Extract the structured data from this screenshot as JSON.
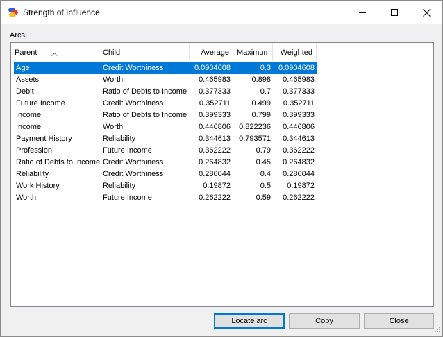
{
  "window": {
    "title": "Strength of Influence",
    "app_icon": "network-icon",
    "controls": [
      "minimize-icon",
      "maximize-icon",
      "close-icon"
    ]
  },
  "arcs_label": "Arcs:",
  "table": {
    "columns": [
      "Parent",
      "Child",
      "Average",
      "Maximum",
      "Weighted"
    ],
    "sorted_column": "Parent",
    "rows": [
      {
        "parent": "Age",
        "child": "Credit Worthiness",
        "average": "0.0904608",
        "maximum": "0.3",
        "weighted": "0.0904608",
        "selected": true
      },
      {
        "parent": "Assets",
        "child": "Worth",
        "average": "0.465983",
        "maximum": "0.898",
        "weighted": "0.465983"
      },
      {
        "parent": "Debit",
        "child": "Ratio of Debts to Income",
        "average": "0.377333",
        "maximum": "0.7",
        "weighted": "0.377333"
      },
      {
        "parent": "Future Income",
        "child": "Credit Worthiness",
        "average": "0.352711",
        "maximum": "0.499",
        "weighted": "0.352711"
      },
      {
        "parent": "Income",
        "child": "Ratio of Debts to Income",
        "average": "0.399333",
        "maximum": "0.799",
        "weighted": "0.399333"
      },
      {
        "parent": "Income",
        "child": "Worth",
        "average": "0.446806",
        "maximum": "0.822236",
        "weighted": "0.446806"
      },
      {
        "parent": "Payment History",
        "child": "Reliability",
        "average": "0.344613",
        "maximum": "0.793571",
        "weighted": "0.344613"
      },
      {
        "parent": "Profession",
        "child": "Future Income",
        "average": "0.362222",
        "maximum": "0.79",
        "weighted": "0.362222"
      },
      {
        "parent": "Ratio of Debts to Income",
        "child": "Credit Worthiness",
        "average": "0.264832",
        "maximum": "0.45",
        "weighted": "0.264832"
      },
      {
        "parent": "Reliability",
        "child": "Credit Worthiness",
        "average": "0.286044",
        "maximum": "0.4",
        "weighted": "0.286044"
      },
      {
        "parent": "Work History",
        "child": "Reliability",
        "average": "0.19872",
        "maximum": "0.5",
        "weighted": "0.19872"
      },
      {
        "parent": "Worth",
        "child": "Future Income",
        "average": "0.262222",
        "maximum": "0.59",
        "weighted": "0.262222"
      }
    ]
  },
  "buttons": {
    "locate": "Locate arc",
    "copy": "Copy",
    "close": "Close"
  },
  "colors": {
    "selection": "#0078d7",
    "default_button_border": "#0078d7"
  }
}
